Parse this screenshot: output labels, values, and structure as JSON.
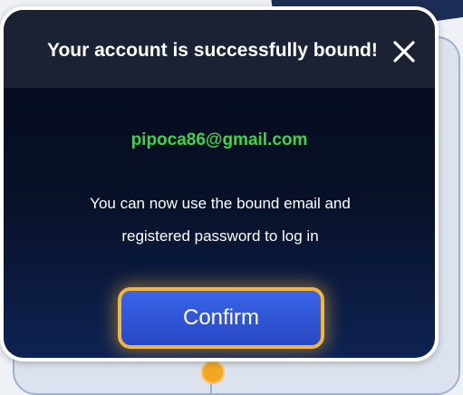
{
  "dialog": {
    "title": "Your account is successfully bound!",
    "close_icon": "close-icon",
    "email": "pipoca86@gmail.com",
    "message_line1": "You can now use the bound email and",
    "message_line2": "registered password to log in",
    "confirm_label": "Confirm"
  },
  "colors": {
    "email": "#3fd44a",
    "button_fill": "#2f55d6",
    "button_border": "#f5b43a",
    "dialog_bg": "#081128",
    "header_bg": "#1a2233"
  }
}
